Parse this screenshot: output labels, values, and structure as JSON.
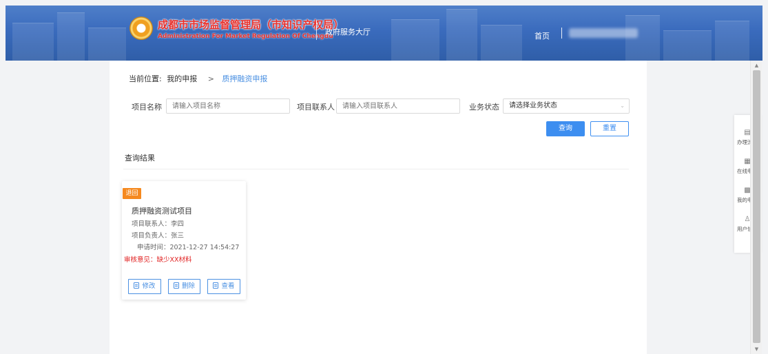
{
  "header": {
    "org_name_cn": "成都市市场监督管理局（市知识产权局）",
    "org_name_en": "Administration For Market Regulation Of Chengdu",
    "hall_label": "政府服务大厅",
    "home_label": "首页"
  },
  "breadcrumb": {
    "prefix": "当前位置:",
    "parent": "我的申报",
    "separator": ">",
    "current": "质押融资申报"
  },
  "search": {
    "project_name_label": "项目名称",
    "project_name_placeholder": "请输入项目名称",
    "contact_label": "项目联系人",
    "contact_placeholder": "请输入项目联系人",
    "status_label": "业务状态",
    "status_value": "请选择业务状态",
    "query_label": "查询",
    "reset_label": "重置"
  },
  "results": {
    "title": "查询结果",
    "cards": [
      {
        "badge": "退回",
        "title": "质押融资测试项目",
        "contact": "项目联系人：李四",
        "owner": "项目负责人：张三",
        "apply_time": "申请时间：2021-12-27 14:54:27",
        "review": "审核意见：缺少XX材料",
        "edit_label": "修改",
        "delete_label": "删除",
        "view_label": "查看"
      }
    ]
  },
  "right_sidebar": {
    "items": [
      {
        "label": "办理流程",
        "icon": "document-icon"
      },
      {
        "label": "在线申报",
        "icon": "online-apply-icon"
      },
      {
        "label": "我的申报",
        "icon": "my-apply-icon"
      },
      {
        "label": "用户信息",
        "icon": "user-icon"
      }
    ]
  },
  "colors": {
    "primary": "#3d8ef0",
    "badge": "#f5891f",
    "danger": "#e02020",
    "header_bg": "#3a6bbd"
  }
}
